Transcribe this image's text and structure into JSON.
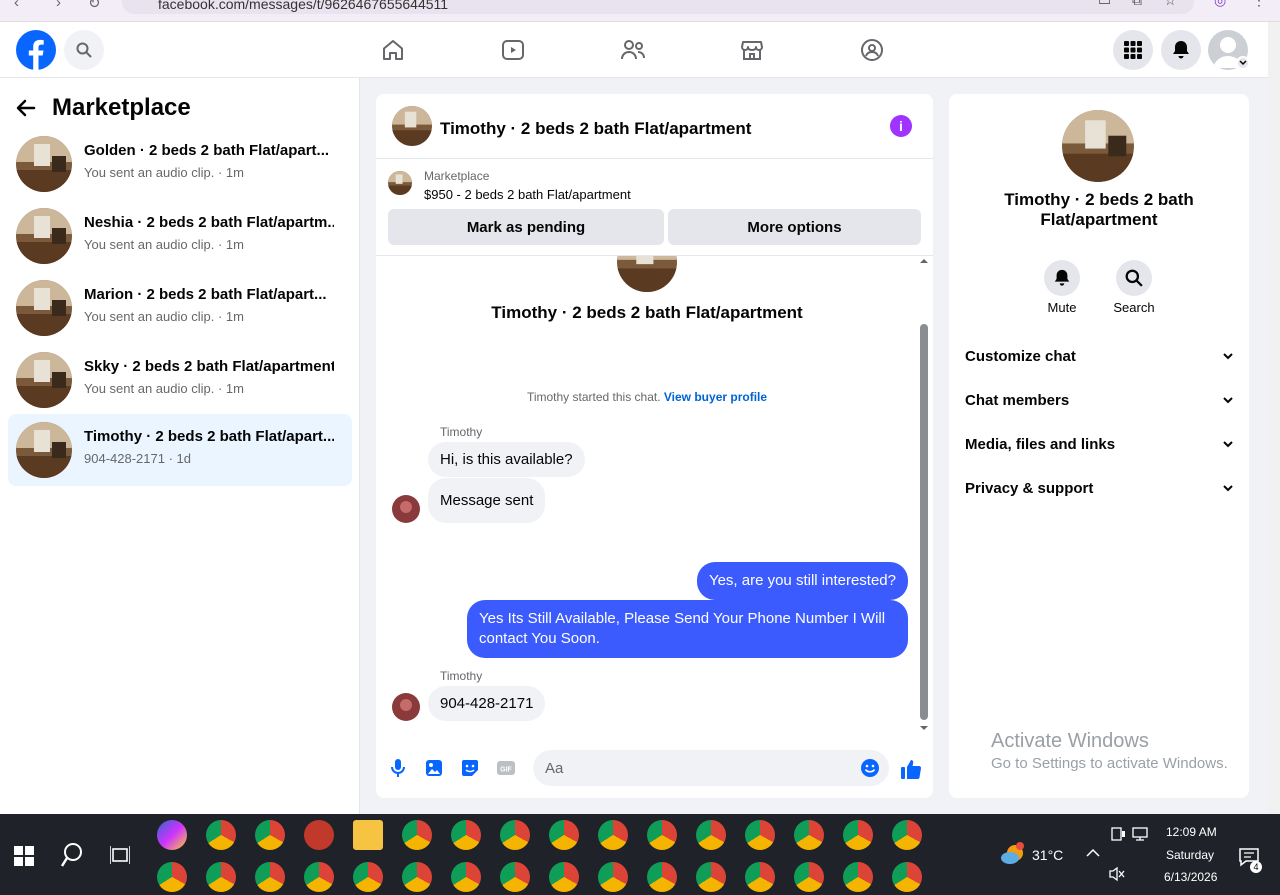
{
  "browser": {
    "url": "facebook.com/messages/t/9626467655644511"
  },
  "header": {
    "nav_tabs": [
      "home",
      "video",
      "friends",
      "marketplace",
      "groups"
    ],
    "colors": {
      "brand": "#0866ff",
      "accent": "#a033ff"
    }
  },
  "left_panel": {
    "title": "Marketplace",
    "conversations": [
      {
        "title": "Golden · 2 beds 2 bath Flat/apart...",
        "subtitle": "You sent an audio clip. · 1m"
      },
      {
        "title": "Neshia · 2 beds 2 bath Flat/apartm...",
        "subtitle": "You sent an audio clip. · 1m"
      },
      {
        "title": "Marion · 2 beds 2 bath Flat/apart...",
        "subtitle": "You sent an audio clip. · 1m"
      },
      {
        "title": "Skky · 2 beds 2 bath Flat/apartment",
        "subtitle": "You sent an audio clip. · 1m"
      },
      {
        "title": "Timothy · 2 beds 2 bath Flat/apart...",
        "subtitle": "904-428-2171 · 1d",
        "active": true
      }
    ]
  },
  "chat": {
    "title": "Timothy · 2 beds 2 bath Flat/apartment",
    "listing": {
      "label": "Marketplace",
      "price_line": "$950 - 2 beds 2 bath Flat/apartment",
      "pending_label": "Mark as pending",
      "more_label": "More options"
    },
    "intro_name": "Timothy · 2 beds 2 bath Flat/apartment",
    "started_text": "Timothy started this chat.",
    "buyer_profile_link": "View buyer profile",
    "messages": [
      {
        "sender": "Timothy",
        "text": "Hi, is this available?",
        "direction": "in"
      },
      {
        "text": "Message sent",
        "direction": "in"
      },
      {
        "text": "Yes, are you still interested?",
        "direction": "out"
      },
      {
        "text": "Yes Its Still Available, Please Send Your Phone Number I Will contact You Soon.",
        "direction": "out"
      },
      {
        "sender": "Timothy",
        "text": "904-428-2171",
        "direction": "in"
      }
    ],
    "composer_placeholder": "Aa"
  },
  "right_panel": {
    "name": "Timothy · 2 beds 2 bath Flat/apartment",
    "mute_label": "Mute",
    "search_label": "Search",
    "sections": [
      "Customize chat",
      "Chat members",
      "Media, files and links",
      "Privacy & support"
    ]
  },
  "watermark": {
    "line1": "Activate Windows",
    "line2": "Go to Settings to activate Windows."
  },
  "taskbar": {
    "temperature": "31°C",
    "time": "12:09 AM",
    "day": "Saturday",
    "date": "6/13/2026",
    "notification_count": "4"
  }
}
